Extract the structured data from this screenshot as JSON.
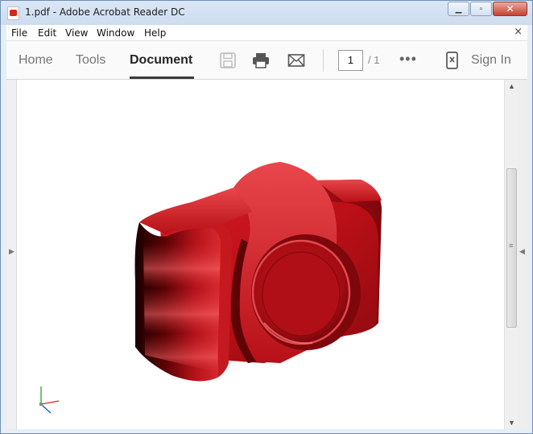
{
  "window": {
    "title": "1.pdf - Adobe Acrobat Reader DC",
    "icon": "pdf-file-icon",
    "controls": {
      "minimize": "minimize-icon",
      "maximize": "maximize-icon",
      "close": "close-icon"
    }
  },
  "menu": {
    "items": [
      "File",
      "Edit",
      "View",
      "Window",
      "Help"
    ],
    "close_glyph": "×"
  },
  "toolbar": {
    "tabs": [
      "Home",
      "Tools",
      "Document"
    ],
    "active_tab": "Document",
    "icons": [
      "save-icon",
      "print-icon",
      "email-icon"
    ],
    "page_current": "1",
    "page_total": "/ 1",
    "more_glyph": "•••",
    "mobile_icon": "mobile-link-icon",
    "sign_in": "Sign In"
  },
  "document": {
    "content": "3d-camera-model",
    "model_color": "#c8121a",
    "axes_icon": "3d-axes-icon"
  },
  "colors": {
    "accent": "#d9261c",
    "titlebar": "#cddcef"
  }
}
